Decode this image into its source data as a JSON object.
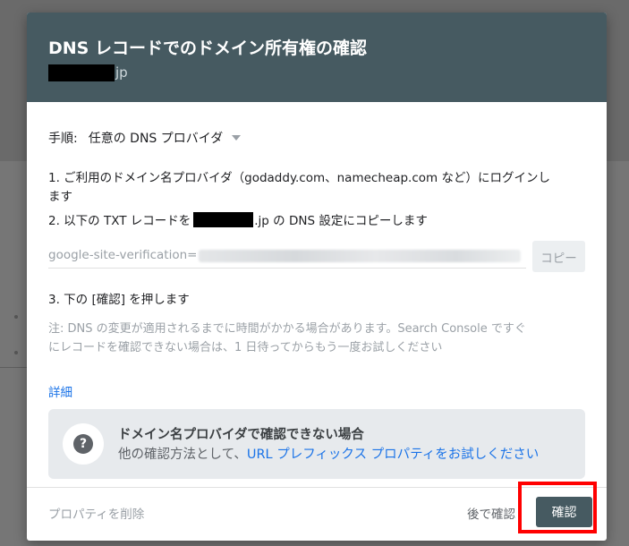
{
  "dialog": {
    "title": "DNS レコードでのドメイン所有権の確認",
    "domain_suffix": "jp"
  },
  "steps": {
    "label": "手順:",
    "provider": "任意の DNS プロバイダ",
    "step1_line1": "1. ご利用のドメイン名プロバイダ（godaddy.com、namecheap.com など）にログインし",
    "step1_line2": "ます",
    "step2_prefix": "2. 以下の TXT レコードを",
    "step2_suffix": ".jp の DNS 設定にコピーします",
    "verification_record": "google-site-verification=",
    "copy_button": "コピー",
    "step3": "3. 下の [確認] を押します"
  },
  "note": {
    "line1": "注: DNS の変更が適用されるまでに時間がかかる場合があります。Search Console ですぐ",
    "line2": "にレコードを確認できない場合は、1 日待ってからもう一度お試しください"
  },
  "details_link": "詳細",
  "info_box": {
    "title": "ドメイン名プロバイダで確認できない場合",
    "sub_text": "他の確認方法として、",
    "sub_link": "URL プレフィックス プロパティをお試しください"
  },
  "footer": {
    "remove_label": "プロパティを削除",
    "later_label": "後で確認",
    "confirm_label": "確認"
  },
  "colors": {
    "header_bg": "#465a61",
    "link": "#1a73e8",
    "highlight": "#ff0000"
  }
}
